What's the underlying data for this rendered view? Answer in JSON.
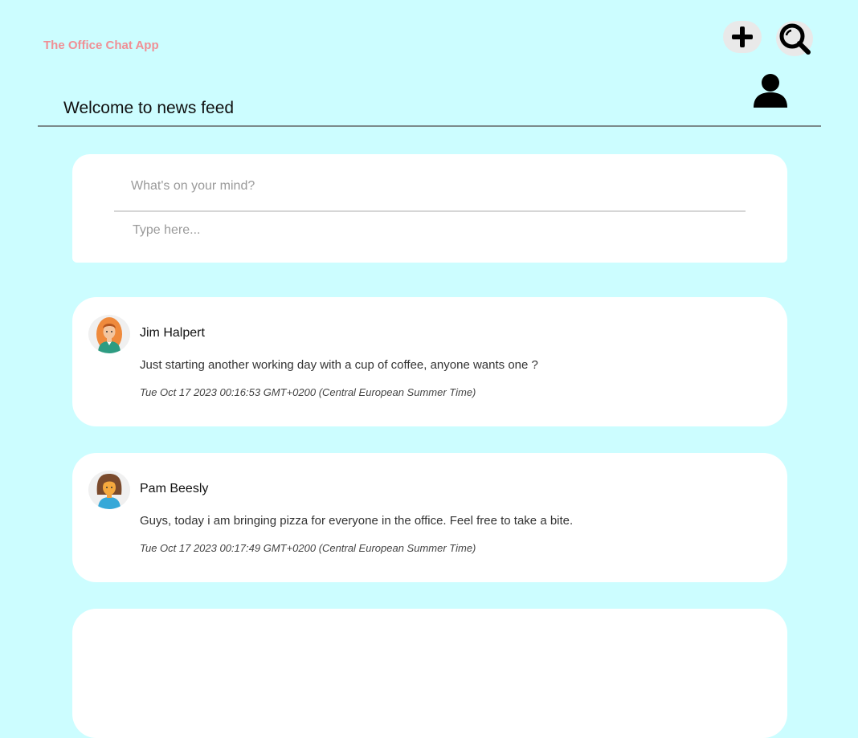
{
  "app": {
    "title": "The Office Chat App"
  },
  "header": {
    "page_title": "Welcome to news feed",
    "add_icon": "plus-icon",
    "search_icon": "search-icon",
    "profile_icon": "user-icon"
  },
  "composer": {
    "title_placeholder": "What's on your mind?",
    "body_placeholder": "Type here..."
  },
  "posts": [
    {
      "author": "Jim Halpert",
      "avatar": "man-avatar",
      "text": "Just starting another working day with a cup of coffee, anyone wants one ?",
      "timestamp": "Tue Oct 17 2023 00:16:53 GMT+0200 (Central European Summer Time)"
    },
    {
      "author": "Pam Beesly",
      "avatar": "woman-avatar",
      "text": "Guys, today i am bringing pizza for everyone in the office. Feel free to take a bite.",
      "timestamp": "Tue Oct 17 2023 00:17:49 GMT+0200 (Central European Summer Time)"
    }
  ],
  "colors": {
    "background": "#ccfdff",
    "card": "#ffffff",
    "brand": "#f08f95",
    "divider": "#7b8a8b"
  }
}
